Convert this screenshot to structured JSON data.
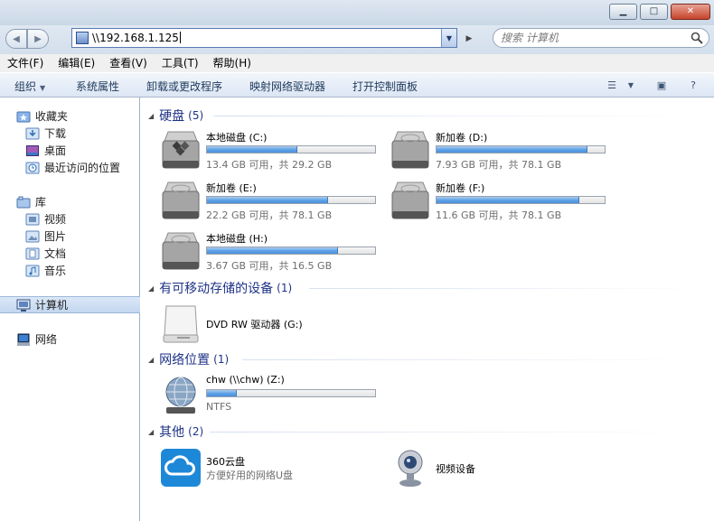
{
  "address": {
    "path": "\\\\192.168.1.125",
    "search_placeholder": "搜索 计算机"
  },
  "menu": [
    "文件(F)",
    "编辑(E)",
    "查看(V)",
    "工具(T)",
    "帮助(H)"
  ],
  "toolbar": {
    "organize": "组织",
    "system_properties": "系统属性",
    "uninstall": "卸载或更改程序",
    "map_drive": "映射网络驱动器",
    "control_panel": "打开控制面板"
  },
  "sidebar": {
    "favorites": "收藏夹",
    "downloads": "下载",
    "desktop": "桌面",
    "recent": "最近访问的位置",
    "libraries": "库",
    "videos": "视频",
    "pictures": "图片",
    "documents": "文档",
    "music": "音乐",
    "computer": "计算机",
    "network": "网络"
  },
  "groups": {
    "hdd": {
      "name": "硬盘",
      "count": "(5)"
    },
    "removable": {
      "name": "有可移动存储的设备",
      "count": "(1)"
    },
    "network": {
      "name": "网络位置",
      "count": "(1)"
    },
    "other": {
      "name": "其他",
      "count": "(2)"
    }
  },
  "drives": [
    {
      "name": "本地磁盘 (C:)",
      "free": "13.4 GB 可用，共 29.2 GB",
      "used_fraction": 0.54
    },
    {
      "name": "新加卷 (D:)",
      "free": "7.93 GB 可用，共 78.1 GB",
      "used_fraction": 0.9
    },
    {
      "name": "新加卷 (E:)",
      "free": "22.2 GB 可用，共 78.1 GB",
      "used_fraction": 0.72
    },
    {
      "name": "新加卷 (F:)",
      "free": "11.6 GB 可用，共 78.1 GB",
      "used_fraction": 0.85
    },
    {
      "name": "本地磁盘 (H:)",
      "free": "3.67 GB 可用，共 16.5 GB",
      "used_fraction": 0.78
    }
  ],
  "dvd": {
    "name": "DVD RW 驱动器 (G:)"
  },
  "netdrive": {
    "name": "chw (\\\\chw) (Z:)",
    "fs": "NTFS",
    "used_fraction": 0.18
  },
  "other": {
    "cloud_name": "360云盘",
    "cloud_desc": "方便好用的网络U盘",
    "camera_name": "视频设备"
  },
  "colors": {
    "accent": "#1e3287",
    "bar_fill": "#5da0e6",
    "selection": "#c3d7f0"
  }
}
